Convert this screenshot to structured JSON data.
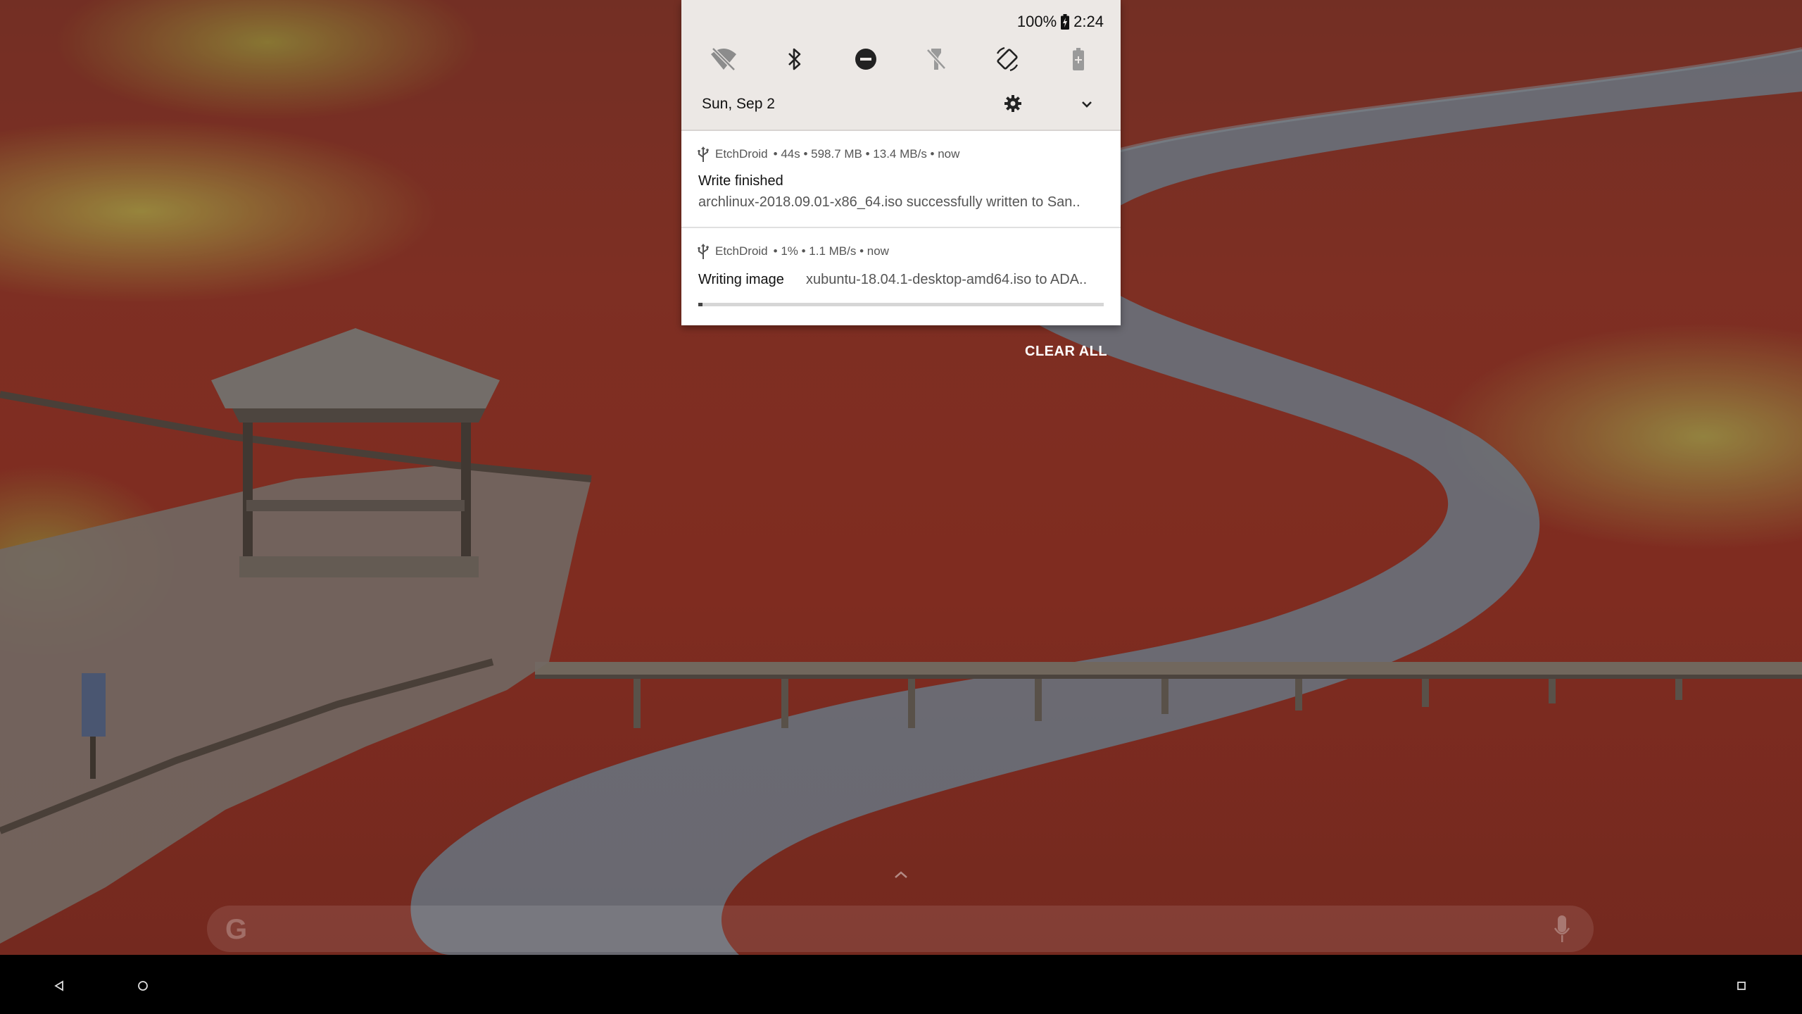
{
  "status_bar": {
    "battery_percent": "100%",
    "time": "2:24"
  },
  "quick_settings": {
    "date": "Sun, Sep 2",
    "tiles": [
      {
        "icon": "wifi-off-icon",
        "state": "off"
      },
      {
        "icon": "bluetooth-icon",
        "state": "on"
      },
      {
        "icon": "do-not-disturb-icon",
        "state": "on"
      },
      {
        "icon": "flashlight-off-icon",
        "state": "off"
      },
      {
        "icon": "auto-rotate-icon",
        "state": "on"
      },
      {
        "icon": "battery-saver-icon",
        "state": "off"
      }
    ]
  },
  "notifications": [
    {
      "app": "EtchDroid",
      "meta": "• 44s • 598.7 MB • 13.4 MB/s • now",
      "title": "Write finished",
      "text": "archlinux-2018.09.01-x86_64.iso successfully written to San.."
    },
    {
      "app": "EtchDroid",
      "meta": "• 1% • 1.1 MB/s • now",
      "title": "Writing image",
      "text": "xubuntu-18.04.1-desktop-amd64.iso to ADA..",
      "progress_fraction": 0.01
    }
  ],
  "clear_all_label": "CLEAR ALL",
  "colors": {
    "shade_header": "#ece8e5",
    "notification_bg": "#ffffff",
    "nav_bar": "#000000"
  }
}
